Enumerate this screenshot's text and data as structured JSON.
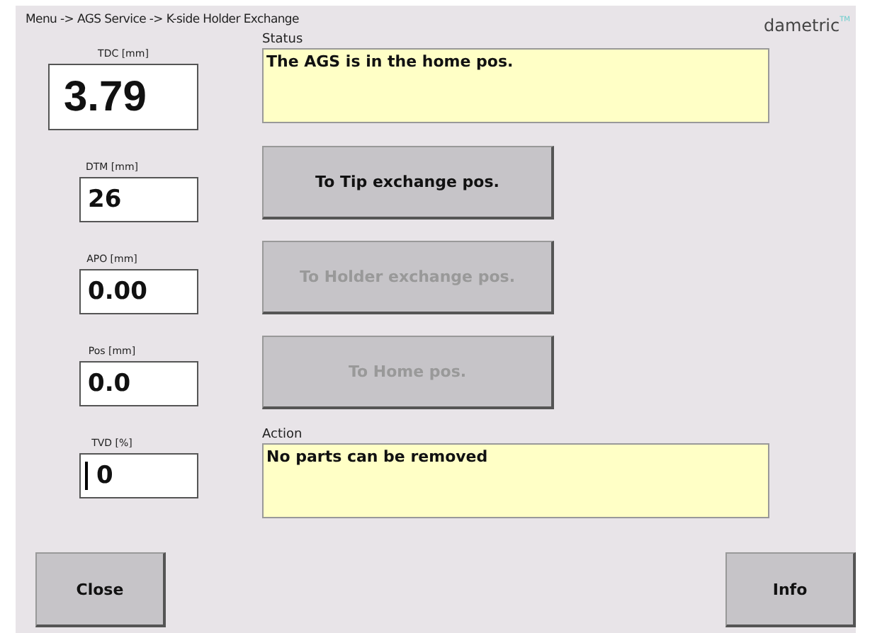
{
  "breadcrumb": "Menu -> AGS Service -> K-side Holder Exchange",
  "logo": {
    "name": "dametric",
    "mark": "TM"
  },
  "fields": [
    {
      "label": "TDC [mm]",
      "value": "3.79",
      "kind": "large",
      "focused": false
    },
    {
      "label": "DTM [mm]",
      "value": "26",
      "kind": "small",
      "focused": false
    },
    {
      "label": "APO [mm]",
      "value": "0.00",
      "kind": "small",
      "focused": false
    },
    {
      "label": "Pos [mm]",
      "value": "0.0",
      "kind": "small",
      "focused": false
    },
    {
      "label": "TVD [%]",
      "value": "0",
      "kind": "small",
      "focused": true
    }
  ],
  "status": {
    "label": "Status",
    "text": "The AGS is in the home pos."
  },
  "actions": [
    {
      "label": "To Tip exchange pos.",
      "disabled": false
    },
    {
      "label": "To Holder exchange pos.",
      "disabled": true
    },
    {
      "label": "To Home pos.",
      "disabled": true
    }
  ],
  "action": {
    "label": "Action",
    "text": "No parts can be removed"
  },
  "buttons": [
    {
      "label": "Close"
    },
    {
      "label": "Info"
    }
  ]
}
